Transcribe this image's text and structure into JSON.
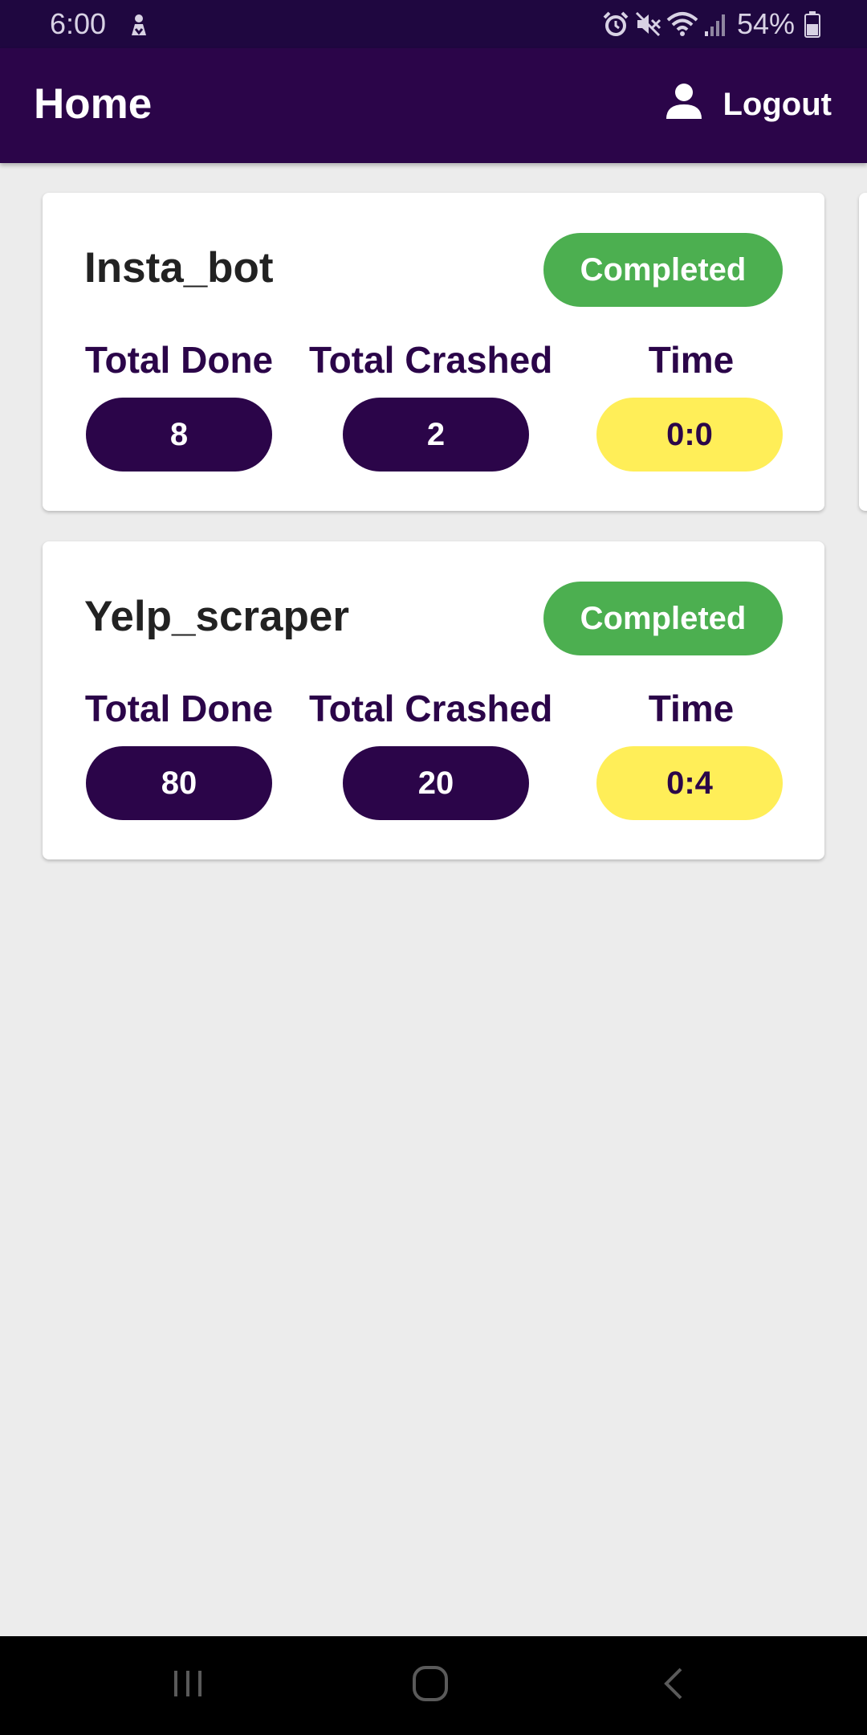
{
  "status_bar": {
    "time": "6:00",
    "battery_percent": "54%",
    "icons": [
      "download-notification-icon",
      "alarm-icon",
      "mute-icon",
      "wifi-icon",
      "signal-icon",
      "battery-icon"
    ]
  },
  "app_bar": {
    "title": "Home",
    "logout_label": "Logout",
    "logout_icon": "user-icon"
  },
  "colors": {
    "primary": "#2b0549",
    "status_bar": "#1f0740",
    "completed": "#4caf50",
    "time_pill": "#ffee58",
    "background": "#ececec"
  },
  "bots": [
    {
      "name": "Insta_bot",
      "status": "Completed",
      "labels": {
        "done": "Total Done",
        "crashed": "Total Crashed",
        "time": "Time"
      },
      "total_done": "8",
      "total_crashed": "2",
      "time": "0:0"
    },
    {
      "name": "Yelp_scraper",
      "status": "Completed",
      "labels": {
        "done": "Total Done",
        "crashed": "Total Crashed",
        "time": "Time"
      },
      "total_done": "80",
      "total_crashed": "20",
      "time": "0:4"
    }
  ],
  "nav_bar": {
    "buttons": [
      "recents-icon",
      "home-icon",
      "back-icon"
    ]
  }
}
